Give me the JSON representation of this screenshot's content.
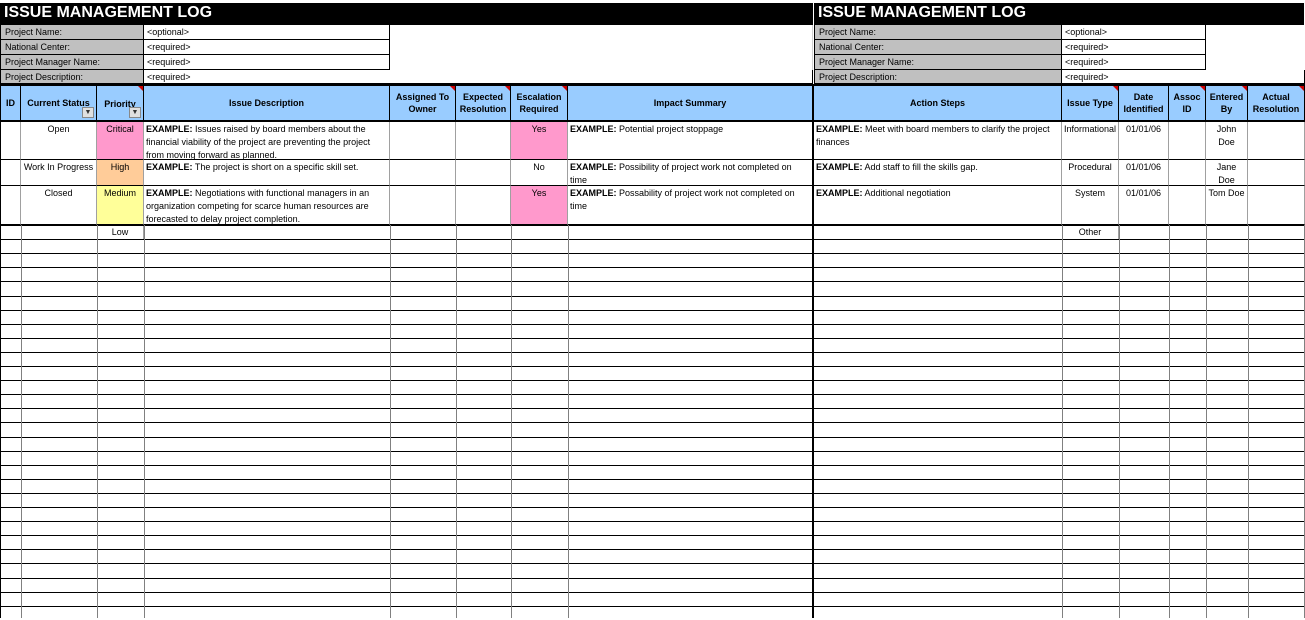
{
  "title": "ISSUE MANAGEMENT LOG",
  "project_info": [
    {
      "label": "Project Name:",
      "value": "<optional>"
    },
    {
      "label": "National Center:",
      "value": "<required>"
    },
    {
      "label": "Project Manager Name:",
      "value": "<required>"
    },
    {
      "label": "Project Description:",
      "value": "<required>"
    }
  ],
  "headers": {
    "id": "ID",
    "current_status": "Current Status",
    "priority": "Priority",
    "issue_description": "Issue Description",
    "assigned_to_owner": "Assigned To Owner",
    "expected_resolution": "Expected Resolution",
    "escalation_required": "Escalation Required",
    "impact_summary": "Impact Summary",
    "action_steps": "Action Steps",
    "issue_type": "Issue Type",
    "date_identified": "Date Identified",
    "assoc_id": "Assoc ID",
    "entered_by": "Entered By",
    "actual_resolution": "Actual Resolution"
  },
  "example_prefix": "EXAMPLE:",
  "rows": [
    {
      "status": "Open",
      "priority": "Critical",
      "issue": "Issues raised by board members about the financial viability of the project are preventing the project from moving forward as planned.",
      "escalation": "Yes",
      "impact": "Potential project stoppage",
      "action": "Meet with board members to clarify the project finances",
      "type": "Informational",
      "date": "01/01/06",
      "entered_by": "John Doe"
    },
    {
      "status": "Work In Progress",
      "priority": "High",
      "issue": "The project is short on a specific skill set.",
      "escalation": "No",
      "impact": "Possibility of project work not completed on time",
      "action": "Add staff to fill the skills gap.",
      "type": "Procedural",
      "date": "01/01/06",
      "entered_by": "Jane Doe"
    },
    {
      "status": "Closed",
      "priority": "Medium",
      "issue": "Negotiations with functional managers in an organization competing for scarce human resources are forecasted to delay project completion.",
      "escalation": "Yes",
      "impact": "Possability of project work not completed on time",
      "action": "Additional negotiation",
      "type": "System",
      "date": "01/01/06",
      "entered_by": "Tom Doe"
    }
  ],
  "extra_priority": "Low",
  "extra_type": "Other",
  "colors": {
    "header_bg": "#99ccff",
    "label_bg": "#c0c0c0",
    "critical": "#ff99cc",
    "high": "#ffcc99",
    "medium": "#ffff99",
    "escalation_yes": "#ff99cc"
  }
}
